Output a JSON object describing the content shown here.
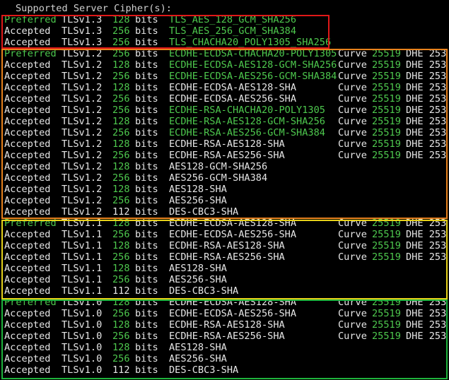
{
  "header": "Supported Server Cipher(s):",
  "colors": {
    "green": "#4ec94e",
    "white": "#e6e6e6",
    "red_box": "#e01818",
    "orange_box": "#e8821c",
    "yellow_box": "#e6d21a",
    "green_box": "#1eb43c"
  },
  "groups": [
    {
      "name": "tls13",
      "box_color": "red",
      "rows": [
        {
          "status": "Preferred",
          "protocol": "TLSv1.3",
          "bits": "128",
          "cipher": "TLS_AES_128_GCM_SHA256",
          "cipher_color": "green",
          "status_color": "green",
          "curve": "",
          "curve_bits": "",
          "dhe": ""
        },
        {
          "status": "Accepted",
          "protocol": "TLSv1.3",
          "bits": "256",
          "cipher": "TLS_AES_256_GCM_SHA384",
          "cipher_color": "green",
          "status_color": "white",
          "curve": "",
          "curve_bits": "",
          "dhe": ""
        },
        {
          "status": "Accepted",
          "protocol": "TLSv1.3",
          "bits": "256",
          "cipher": "TLS_CHACHA20_POLY1305_SHA256",
          "cipher_color": "green",
          "status_color": "white",
          "curve": "",
          "curve_bits": "",
          "dhe": ""
        }
      ]
    },
    {
      "name": "tls12",
      "box_color": "orange",
      "rows": [
        {
          "status": "Preferred",
          "protocol": "TLSv1.2",
          "bits": "256",
          "cipher": "ECDHE-ECDSA-CHACHA20-POLY1305",
          "cipher_color": "green",
          "status_color": "green",
          "curve": "Curve",
          "curve_bits": "25519",
          "dhe": "DHE 253"
        },
        {
          "status": "Accepted",
          "protocol": "TLSv1.2",
          "bits": "128",
          "cipher": "ECDHE-ECDSA-AES128-GCM-SHA256",
          "cipher_color": "green",
          "status_color": "white",
          "curve": "Curve",
          "curve_bits": "25519",
          "dhe": "DHE 253"
        },
        {
          "status": "Accepted",
          "protocol": "TLSv1.2",
          "bits": "256",
          "cipher": "ECDHE-ECDSA-AES256-GCM-SHA384",
          "cipher_color": "green",
          "status_color": "white",
          "curve": "Curve",
          "curve_bits": "25519",
          "dhe": "DHE 253"
        },
        {
          "status": "Accepted",
          "protocol": "TLSv1.2",
          "bits": "128",
          "cipher": "ECDHE-ECDSA-AES128-SHA",
          "cipher_color": "white",
          "status_color": "white",
          "curve": "Curve",
          "curve_bits": "25519",
          "dhe": "DHE 253"
        },
        {
          "status": "Accepted",
          "protocol": "TLSv1.2",
          "bits": "256",
          "cipher": "ECDHE-ECDSA-AES256-SHA",
          "cipher_color": "white",
          "status_color": "white",
          "curve": "Curve",
          "curve_bits": "25519",
          "dhe": "DHE 253"
        },
        {
          "status": "Accepted",
          "protocol": "TLSv1.2",
          "bits": "256",
          "cipher": "ECDHE-RSA-CHACHA20-POLY1305",
          "cipher_color": "green",
          "status_color": "white",
          "curve": "Curve",
          "curve_bits": "25519",
          "dhe": "DHE 253"
        },
        {
          "status": "Accepted",
          "protocol": "TLSv1.2",
          "bits": "128",
          "cipher": "ECDHE-RSA-AES128-GCM-SHA256",
          "cipher_color": "green",
          "status_color": "white",
          "curve": "Curve",
          "curve_bits": "25519",
          "dhe": "DHE 253"
        },
        {
          "status": "Accepted",
          "protocol": "TLSv1.2",
          "bits": "256",
          "cipher": "ECDHE-RSA-AES256-GCM-SHA384",
          "cipher_color": "green",
          "status_color": "white",
          "curve": "Curve",
          "curve_bits": "25519",
          "dhe": "DHE 253"
        },
        {
          "status": "Accepted",
          "protocol": "TLSv1.2",
          "bits": "128",
          "cipher": "ECDHE-RSA-AES128-SHA",
          "cipher_color": "white",
          "status_color": "white",
          "curve": "Curve",
          "curve_bits": "25519",
          "dhe": "DHE 253"
        },
        {
          "status": "Accepted",
          "protocol": "TLSv1.2",
          "bits": "256",
          "cipher": "ECDHE-RSA-AES256-SHA",
          "cipher_color": "white",
          "status_color": "white",
          "curve": "Curve",
          "curve_bits": "25519",
          "dhe": "DHE 253"
        },
        {
          "status": "Accepted",
          "protocol": "TLSv1.2",
          "bits": "128",
          "cipher": "AES128-GCM-SHA256",
          "cipher_color": "white",
          "status_color": "white",
          "curve": "",
          "curve_bits": "",
          "dhe": ""
        },
        {
          "status": "Accepted",
          "protocol": "TLSv1.2",
          "bits": "256",
          "cipher": "AES256-GCM-SHA384",
          "cipher_color": "white",
          "status_color": "white",
          "curve": "",
          "curve_bits": "",
          "dhe": ""
        },
        {
          "status": "Accepted",
          "protocol": "TLSv1.2",
          "bits": "128",
          "cipher": "AES128-SHA",
          "cipher_color": "white",
          "status_color": "white",
          "curve": "",
          "curve_bits": "",
          "dhe": ""
        },
        {
          "status": "Accepted",
          "protocol": "TLSv1.2",
          "bits": "256",
          "cipher": "AES256-SHA",
          "cipher_color": "white",
          "status_color": "white",
          "curve": "",
          "curve_bits": "",
          "dhe": ""
        },
        {
          "status": "Accepted",
          "protocol": "TLSv1.2",
          "bits": "112",
          "cipher": "DES-CBC3-SHA",
          "cipher_color": "white",
          "status_color": "white",
          "bits_color": "white",
          "curve": "",
          "curve_bits": "",
          "dhe": ""
        }
      ]
    },
    {
      "name": "tls11",
      "box_color": "yellow",
      "rows": [
        {
          "status": "Preferred",
          "protocol": "TLSv1.1",
          "bits": "128",
          "cipher": "ECDHE-ECDSA-AES128-SHA",
          "cipher_color": "white",
          "status_color": "green",
          "curve": "Curve",
          "curve_bits": "25519",
          "dhe": "DHE 253"
        },
        {
          "status": "Accepted",
          "protocol": "TLSv1.1",
          "bits": "256",
          "cipher": "ECDHE-ECDSA-AES256-SHA",
          "cipher_color": "white",
          "status_color": "white",
          "curve": "Curve",
          "curve_bits": "25519",
          "dhe": "DHE 253"
        },
        {
          "status": "Accepted",
          "protocol": "TLSv1.1",
          "bits": "128",
          "cipher": "ECDHE-RSA-AES128-SHA",
          "cipher_color": "white",
          "status_color": "white",
          "curve": "Curve",
          "curve_bits": "25519",
          "dhe": "DHE 253"
        },
        {
          "status": "Accepted",
          "protocol": "TLSv1.1",
          "bits": "256",
          "cipher": "ECDHE-RSA-AES256-SHA",
          "cipher_color": "white",
          "status_color": "white",
          "curve": "Curve",
          "curve_bits": "25519",
          "dhe": "DHE 253"
        },
        {
          "status": "Accepted",
          "protocol": "TLSv1.1",
          "bits": "128",
          "cipher": "AES128-SHA",
          "cipher_color": "white",
          "status_color": "white",
          "curve": "",
          "curve_bits": "",
          "dhe": ""
        },
        {
          "status": "Accepted",
          "protocol": "TLSv1.1",
          "bits": "256",
          "cipher": "AES256-SHA",
          "cipher_color": "white",
          "status_color": "white",
          "curve": "",
          "curve_bits": "",
          "dhe": ""
        },
        {
          "status": "Accepted",
          "protocol": "TLSv1.1",
          "bits": "112",
          "cipher": "DES-CBC3-SHA",
          "cipher_color": "white",
          "status_color": "white",
          "bits_color": "white",
          "curve": "",
          "curve_bits": "",
          "dhe": ""
        }
      ]
    },
    {
      "name": "tls10",
      "box_color": "green",
      "rows": [
        {
          "status": "Preferred",
          "protocol": "TLSv1.0",
          "bits": "128",
          "cipher": "ECDHE-ECDSA-AES128-SHA",
          "cipher_color": "white",
          "status_color": "green",
          "curve": "Curve",
          "curve_bits": "25519",
          "dhe": "DHE 253"
        },
        {
          "status": "Accepted",
          "protocol": "TLSv1.0",
          "bits": "256",
          "cipher": "ECDHE-ECDSA-AES256-SHA",
          "cipher_color": "white",
          "status_color": "white",
          "curve": "Curve",
          "curve_bits": "25519",
          "dhe": "DHE 253"
        },
        {
          "status": "Accepted",
          "protocol": "TLSv1.0",
          "bits": "128",
          "cipher": "ECDHE-RSA-AES128-SHA",
          "cipher_color": "white",
          "status_color": "white",
          "curve": "Curve",
          "curve_bits": "25519",
          "dhe": "DHE 253"
        },
        {
          "status": "Accepted",
          "protocol": "TLSv1.0",
          "bits": "256",
          "cipher": "ECDHE-RSA-AES256-SHA",
          "cipher_color": "white",
          "status_color": "white",
          "curve": "Curve",
          "curve_bits": "25519",
          "dhe": "DHE 253"
        },
        {
          "status": "Accepted",
          "protocol": "TLSv1.0",
          "bits": "128",
          "cipher": "AES128-SHA",
          "cipher_color": "white",
          "status_color": "white",
          "curve": "",
          "curve_bits": "",
          "dhe": ""
        },
        {
          "status": "Accepted",
          "protocol": "TLSv1.0",
          "bits": "256",
          "cipher": "AES256-SHA",
          "cipher_color": "white",
          "status_color": "white",
          "curve": "",
          "curve_bits": "",
          "dhe": ""
        },
        {
          "status": "Accepted",
          "protocol": "TLSv1.0",
          "bits": "112",
          "cipher": "DES-CBC3-SHA",
          "cipher_color": "white",
          "status_color": "white",
          "bits_color": "white",
          "curve": "",
          "curve_bits": "",
          "dhe": ""
        }
      ]
    }
  ],
  "bits_unit": "bits"
}
